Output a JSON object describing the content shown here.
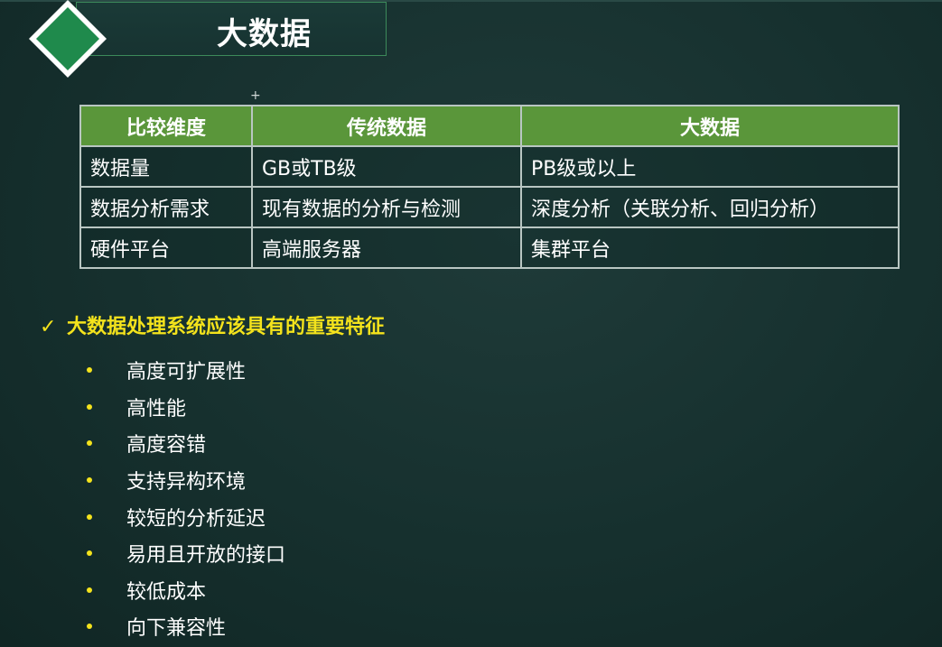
{
  "slide": {
    "title": "大数据"
  },
  "table": {
    "headers": [
      "比较维度",
      "传统数据",
      "大数据"
    ],
    "rows": [
      [
        "数据量",
        "GB或TB级",
        "PB级或以上"
      ],
      [
        "数据分析需求",
        "现有数据的分析与检测",
        "深度分析（关联分析、回归分析）"
      ],
      [
        "硬件平台",
        "高端服务器",
        "集群平台"
      ]
    ]
  },
  "features": {
    "check_icon": "checkmark-icon",
    "heading": "大数据处理系统应该具有的重要特征",
    "items": [
      "高度可扩展性",
      "高性能",
      "高度容错",
      "支持异构环境",
      "较短的分析延迟",
      "易用且开放的接口",
      "较低成本",
      "向下兼容性"
    ]
  },
  "colors": {
    "background": "#16302e",
    "header_green": "#5a963a",
    "diamond_green": "#1f8a4c",
    "accent_yellow": "#f4e31c"
  }
}
